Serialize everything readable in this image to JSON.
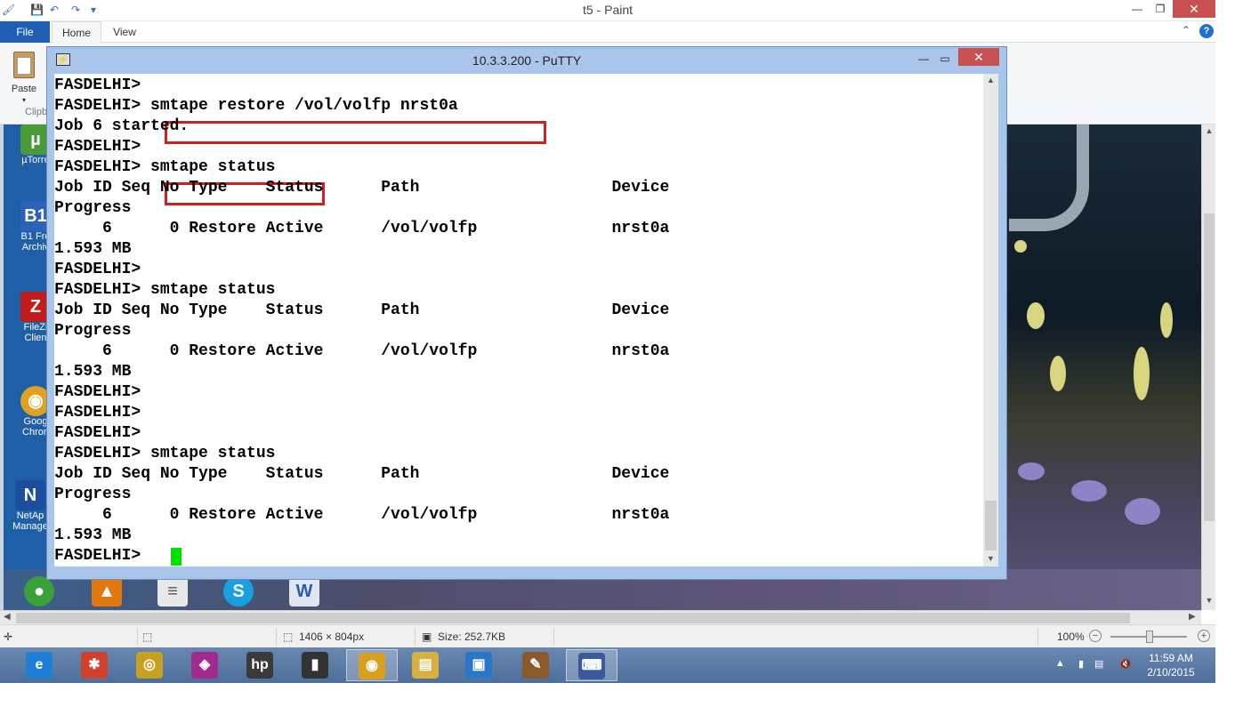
{
  "paint": {
    "title": "t5 - Paint",
    "tabs": {
      "file": "File",
      "home": "Home",
      "view": "View"
    },
    "paste_label": "Paste",
    "clipboard_group": "Clipb",
    "help_glyph": "?",
    "status": {
      "dimensions": "1406 × 804px",
      "size": "Size: 252.7KB",
      "zoom": "100%"
    }
  },
  "desktop_icons": [
    {
      "name": "µTorre",
      "glyph": "µ",
      "color": "#4a9a3a"
    },
    {
      "name": "B1 Fre\nArchiv",
      "glyph": "B1",
      "color": "#2a64b8"
    },
    {
      "name": "FileZi\nClien",
      "glyph": "Z",
      "color": "#c01c1c"
    },
    {
      "name": "Goog\nChron",
      "glyph": "◉",
      "color": "#e0a020"
    },
    {
      "name": "NetAp\nManage",
      "glyph": "N",
      "color": "#1b4f9e"
    }
  ],
  "putty": {
    "title": "10.3.3.200 - PuTTY",
    "lines": [
      "FASDELHI>",
      "FASDELHI> smtape restore /vol/volfp nrst0a",
      "Job 6 started.",
      "FASDELHI>",
      "FASDELHI> smtape status",
      "Job ID Seq No Type    Status      Path                    Device",
      "Progress",
      "     6      0 Restore Active      /vol/volfp              nrst0a",
      "1.593 MB",
      "FASDELHI>",
      "FASDELHI> smtape status",
      "Job ID Seq No Type    Status      Path                    Device",
      "Progress",
      "     6      0 Restore Active      /vol/volfp              nrst0a",
      "1.593 MB",
      "FASDELHI>",
      "FASDELHI>",
      "FASDELHI>",
      "FASDELHI> smtape status",
      "Job ID Seq No Type    Status      Path                    Device",
      "Progress",
      "     6      0 Restore Active      /vol/volfp              nrst0a",
      "1.593 MB",
      "FASDELHI> "
    ],
    "highlight_color": "#d01f1f",
    "cursor_color": "#00e000"
  },
  "taskbar": {
    "apps": [
      {
        "name": "internet-explorer",
        "glyph": "e",
        "color": "#1e7fd6"
      },
      {
        "name": "puzzle-app",
        "glyph": "✱",
        "color": "#d0402a"
      },
      {
        "name": "media-player",
        "glyph": "◎",
        "color": "#c8a020"
      },
      {
        "name": "wifi-app",
        "glyph": "◈",
        "color": "#a02a8e"
      },
      {
        "name": "hp-app",
        "glyph": "hp",
        "color": "#3a3a3a"
      },
      {
        "name": "cursor-tool",
        "glyph": "▮",
        "color": "#333333"
      },
      {
        "name": "chrome",
        "glyph": "◉",
        "color": "#d8a020"
      },
      {
        "name": "file-explorer",
        "glyph": "▤",
        "color": "#d8b040"
      },
      {
        "name": "virtualbox",
        "glyph": "▣",
        "color": "#2a76c8"
      },
      {
        "name": "paint",
        "glyph": "✎",
        "color": "#8a5a2a"
      },
      {
        "name": "putty",
        "glyph": "⌨",
        "color": "#3a5a9a"
      }
    ],
    "clock_time": "11:59 AM",
    "clock_date": "2/10/2015"
  }
}
